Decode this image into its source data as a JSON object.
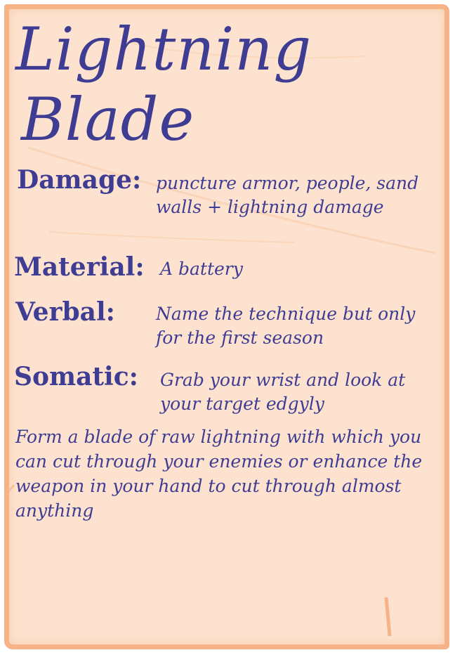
{
  "card": {
    "title_line1": "Lightning",
    "title_line2": "Blade",
    "fields": {
      "damage_label": "Damage:",
      "damage_value": "puncture armor, people, sand walls + lightning damage",
      "material_label": "Material:",
      "material_value": "A battery",
      "verbal_label": "Verbal:",
      "verbal_value": "Name the technique but only for the first season",
      "somatic_label": "Somatic:",
      "somatic_value": "Grab your wrist and look at your target edgyly"
    },
    "description": "Form a blade of raw lightning with which you can cut through your enemies or enhance the weapon in your hand to cut through almost anything"
  },
  "colors": {
    "ink": "#3f3c93",
    "paper": "#fde3cf",
    "border": "#f5b387"
  }
}
